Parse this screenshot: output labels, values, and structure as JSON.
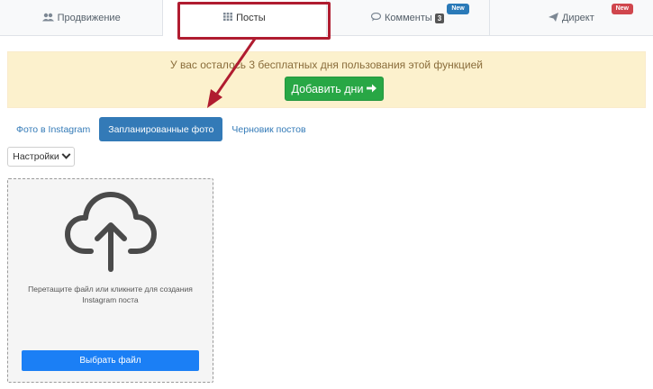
{
  "nav": {
    "tabs": [
      {
        "label": "Продвижение",
        "icon": "users-icon"
      },
      {
        "label": "Посты",
        "icon": "grid-icon",
        "active": true
      },
      {
        "label": "Комменты",
        "icon": "comment-icon",
        "count": "3",
        "badge": "New",
        "badge_color": "#2a7ab8"
      },
      {
        "label": "Директ",
        "icon": "paper-plane-icon",
        "badge": "New",
        "badge_color": "#d0464d"
      }
    ]
  },
  "alert": {
    "text": "У вас осталось 3 бесплатных дня пользования этой функцией",
    "button_label": "Добавить дни"
  },
  "subtabs": [
    {
      "label": "Фото в Instagram"
    },
    {
      "label": "Запланированные фото",
      "active": true
    },
    {
      "label": "Черновик постов"
    }
  ],
  "settings": {
    "label": "Настройки"
  },
  "upload": {
    "text": "Перетащите файл или кликните для создания Instagram поста",
    "button_label": "Выбрать файл"
  },
  "colors": {
    "primary": "#337ab7",
    "success": "#28a745",
    "alert_bg": "#fcf1cd",
    "annotation": "#b01c30",
    "upload_button": "#1b7ff5"
  }
}
